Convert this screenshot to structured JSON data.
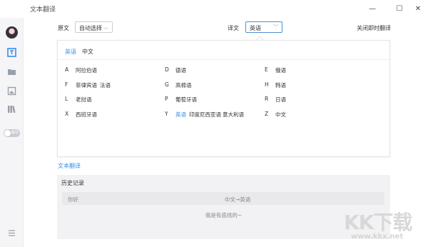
{
  "app": {
    "title": "文本翻译"
  },
  "window_controls": {
    "minimize": "—",
    "maximize": "☐",
    "close": "✕"
  },
  "sidebar": {
    "toggle_label": "翻译"
  },
  "source": {
    "label": "原文",
    "value": "自动选择"
  },
  "target": {
    "label": "译文",
    "value": "英语"
  },
  "close_instant": "关闭即时翻译",
  "lang_panel": {
    "tabs": [
      "英语",
      "中文"
    ],
    "rows": [
      {
        "left": {
          "letter": "A",
          "langs": [
            "阿拉伯语"
          ]
        },
        "mid": {
          "letter": "D",
          "langs": [
            "德语"
          ]
        },
        "right": {
          "letter": "E",
          "langs": [
            "俄语"
          ]
        }
      },
      {
        "left": {
          "letter": "F",
          "langs": [
            "菲律宾语",
            "法语"
          ]
        },
        "mid": {
          "letter": "G",
          "langs": [
            "高棉语"
          ]
        },
        "right": {
          "letter": "H",
          "langs": [
            "韩语"
          ]
        }
      },
      {
        "left": {
          "letter": "L",
          "langs": [
            "老挝语"
          ]
        },
        "mid": {
          "letter": "P",
          "langs": [
            "葡萄牙语"
          ]
        },
        "right": {
          "letter": "R",
          "langs": [
            "日语"
          ]
        }
      },
      {
        "left": {
          "letter": "X",
          "langs": [
            "西班牙语"
          ]
        },
        "mid": {
          "letter": "Y",
          "langs": [
            "英语",
            "印度尼西亚语",
            "意大利语"
          ]
        },
        "right": {
          "letter": "Z",
          "langs": [
            "中文"
          ]
        }
      }
    ]
  },
  "text_translate_link": "文本翻译",
  "history": {
    "title": "历史记录",
    "row": {
      "source": "你好",
      "direction": "中文→英语"
    },
    "end_text": "我是有底线的~"
  },
  "watermark": {
    "text": "KK下载",
    "url": "www.kkx.net"
  },
  "colors": {
    "accent": "#3a8ee6",
    "sidebar": "#f5f5f7",
    "history_bg": "#f2f2f4"
  }
}
